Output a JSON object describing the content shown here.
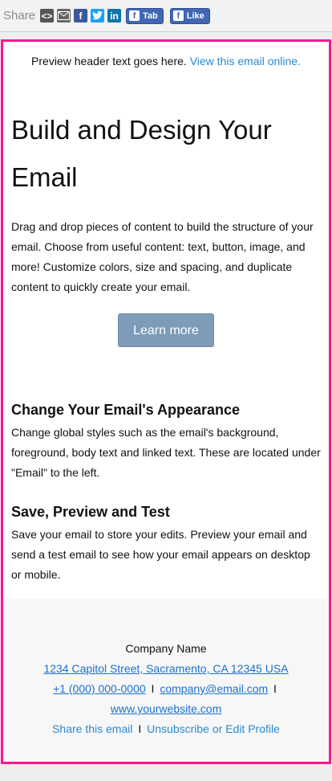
{
  "share_bar": {
    "share_label": "Share",
    "icons": [
      "embed-icon",
      "email-icon",
      "facebook-icon",
      "twitter-icon",
      "linkedin-icon"
    ],
    "tab_label": "Tab",
    "like_label": "Like"
  },
  "colors": {
    "frame_border": "#ff1493",
    "link": "#2a89d0",
    "button_bg": "#7c9cb7",
    "footer_bg": "#f7f7f7"
  },
  "email": {
    "preview_text": "Preview header text goes here.",
    "view_online": "View this email online.",
    "title_line1": "Build and Design Your",
    "title_line2": "Email",
    "intro": "Drag and drop pieces of content to build the structure of your email. Choose from useful content: text, button, image, and more! Customize colors, size and spacing, and duplicate content to quickly create your email.",
    "button_label": "Learn more",
    "section1_heading": "Change Your Email's Appearance",
    "section1_body": "Change global styles such as the email's background, foreground, body text and linked text. These are located under \"Email\" to the left.",
    "section2_heading": "Save, Preview and Test",
    "section2_body": "Save your email to store your edits. Preview your email and send a test email to see how your email appears on desktop or mobile."
  },
  "footer": {
    "company": "Company Name",
    "address": "1234 Capitol Street, Sacramento, CA 12345 USA",
    "phone": "+1 (000) 000-0000",
    "separator": "I",
    "email": "company@email.com",
    "website": "www.yourwebsite.com",
    "share_email": "Share this email",
    "unsubscribe": "Unsubscribe or Edit Profile"
  }
}
